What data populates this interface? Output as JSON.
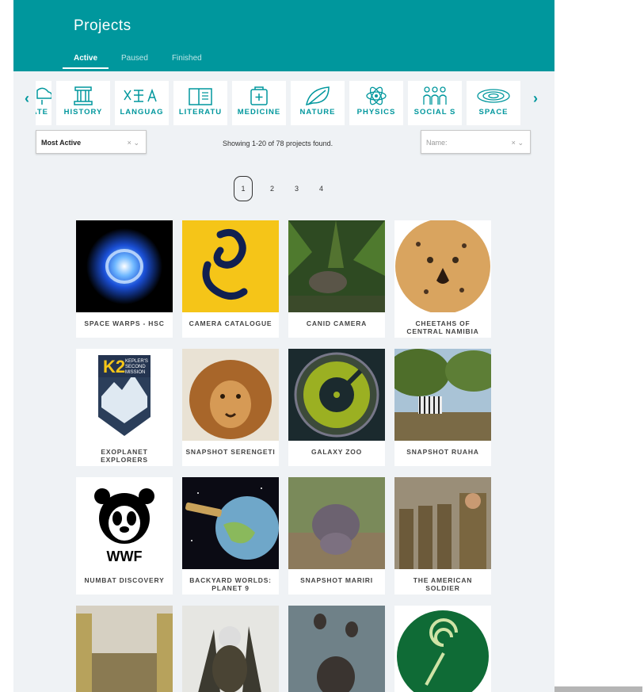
{
  "header": {
    "title": "Projects",
    "tabs": [
      "Active",
      "Paused",
      "Finished"
    ]
  },
  "disciplines": [
    {
      "label": "MATE",
      "icon": "climate-icon"
    },
    {
      "label": "HISTORY",
      "icon": "history-icon"
    },
    {
      "label": "LANGUAG",
      "icon": "language-icon"
    },
    {
      "label": "LITERATU",
      "icon": "literature-icon"
    },
    {
      "label": "MEDICINE",
      "icon": "medicine-icon"
    },
    {
      "label": "NATURE",
      "icon": "nature-icon"
    },
    {
      "label": "PHYSICS",
      "icon": "physics-icon"
    },
    {
      "label": "SOCIAL S",
      "icon": "social-science-icon"
    },
    {
      "label": "SPACE",
      "icon": "space-icon"
    }
  ],
  "nav": {
    "prev": "‹",
    "next": "›"
  },
  "filters": {
    "sort": {
      "value": "Most Active",
      "clear": "×",
      "caret": "⌄"
    },
    "showing": "Showing 1-20 of 78 projects found.",
    "name": {
      "placeholder": "Name:",
      "clear": "×",
      "caret": "⌄"
    }
  },
  "pagination": [
    "1",
    "2",
    "3",
    "4"
  ],
  "projects": [
    {
      "name": "SPACE WARPS - HSC"
    },
    {
      "name": "CAMERA CATALOGUE"
    },
    {
      "name": "CANID CAMERA"
    },
    {
      "name": "CHEETAHS OF CENTRAL NAMIBIA"
    },
    {
      "name": "EXOPLANET EXPLORERS",
      "badge": {
        "big": "K2",
        "small1": "KEPLER'S",
        "small2": "SECOND",
        "small3": "MISSION"
      }
    },
    {
      "name": "SNAPSHOT SERENGETI"
    },
    {
      "name": "GALAXY ZOO"
    },
    {
      "name": "SNAPSHOT RUAHA"
    },
    {
      "name": "NUMBAT DISCOVERY",
      "logo_text": "WWF"
    },
    {
      "name": "BACKYARD WORLDS: PLANET 9"
    },
    {
      "name": "SNAPSHOT MARIRI"
    },
    {
      "name": "THE AMERICAN SOLDIER"
    },
    {
      "name": ""
    },
    {
      "name": ""
    },
    {
      "name": ""
    },
    {
      "name": ""
    }
  ],
  "colors": {
    "brand": "#00979d",
    "background": "#eff2f5"
  }
}
